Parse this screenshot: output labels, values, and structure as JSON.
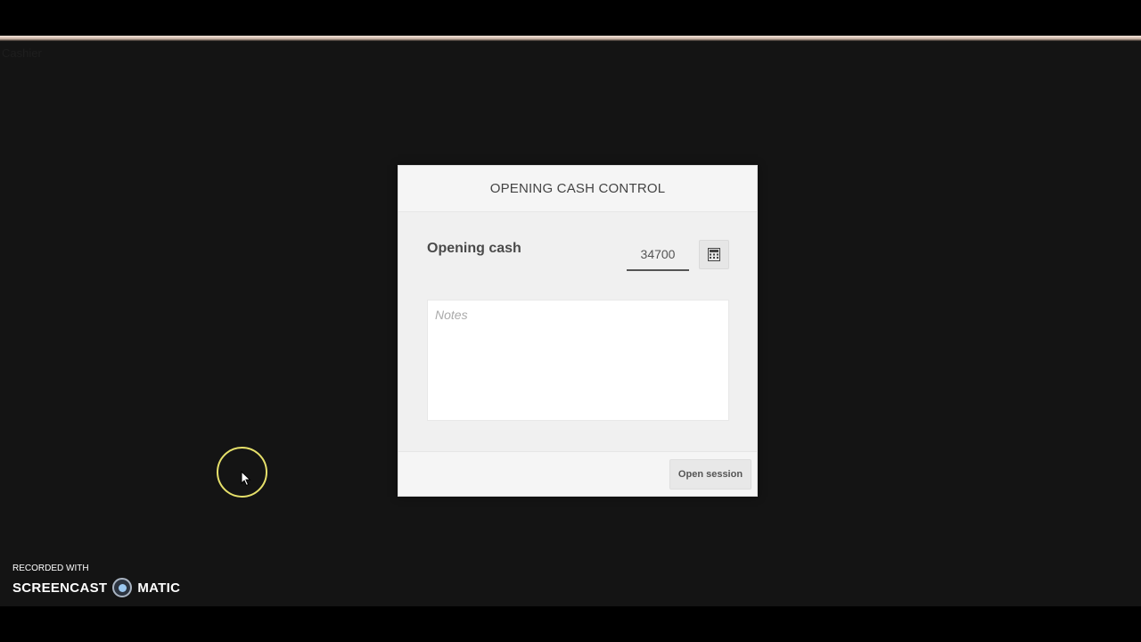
{
  "backdrop": {
    "faint_text": "Cashier"
  },
  "modal": {
    "title": "OPENING CASH CONTROL",
    "opening_cash_label": "Opening cash",
    "opening_cash_value": "34700",
    "calculator_icon": "calculator-icon",
    "notes_placeholder": "Notes",
    "open_session_label": "Open session"
  },
  "watermark": {
    "recorded_with": "RECORDED WITH",
    "brand_left": "SCREENCAST",
    "brand_right": "MATIC"
  },
  "colors": {
    "backdrop": "#141414",
    "modal_bg": "#f0f0f0",
    "cursor_ring": "#e6e06a"
  }
}
